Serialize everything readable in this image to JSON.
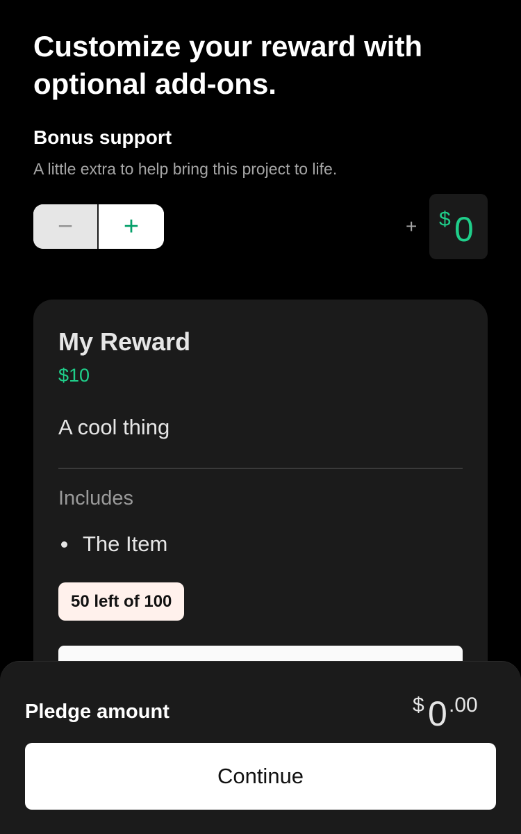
{
  "header": {
    "title": "Customize your reward with optional add-ons."
  },
  "bonus": {
    "title": "Bonus support",
    "subtitle": "A little extra to help bring this project to life.",
    "minus_symbol": "−",
    "plus_symbol": "+",
    "amount_prefix": "+",
    "currency": "$",
    "amount": "0"
  },
  "reward": {
    "title": "My Reward",
    "price": "$10",
    "description": "A cool thing",
    "includes_label": "Includes",
    "items": [
      "The Item"
    ],
    "stock_badge": "50 left of 100"
  },
  "footer": {
    "pledge_label": "Pledge amount",
    "currency": "$",
    "amount_whole": "0",
    "amount_cents": ".00",
    "continue_label": "Continue"
  },
  "colors": {
    "accent_green": "#1fce8a",
    "background": "#000000",
    "card": "#1b1b1b",
    "badge": "#fff1ec"
  }
}
